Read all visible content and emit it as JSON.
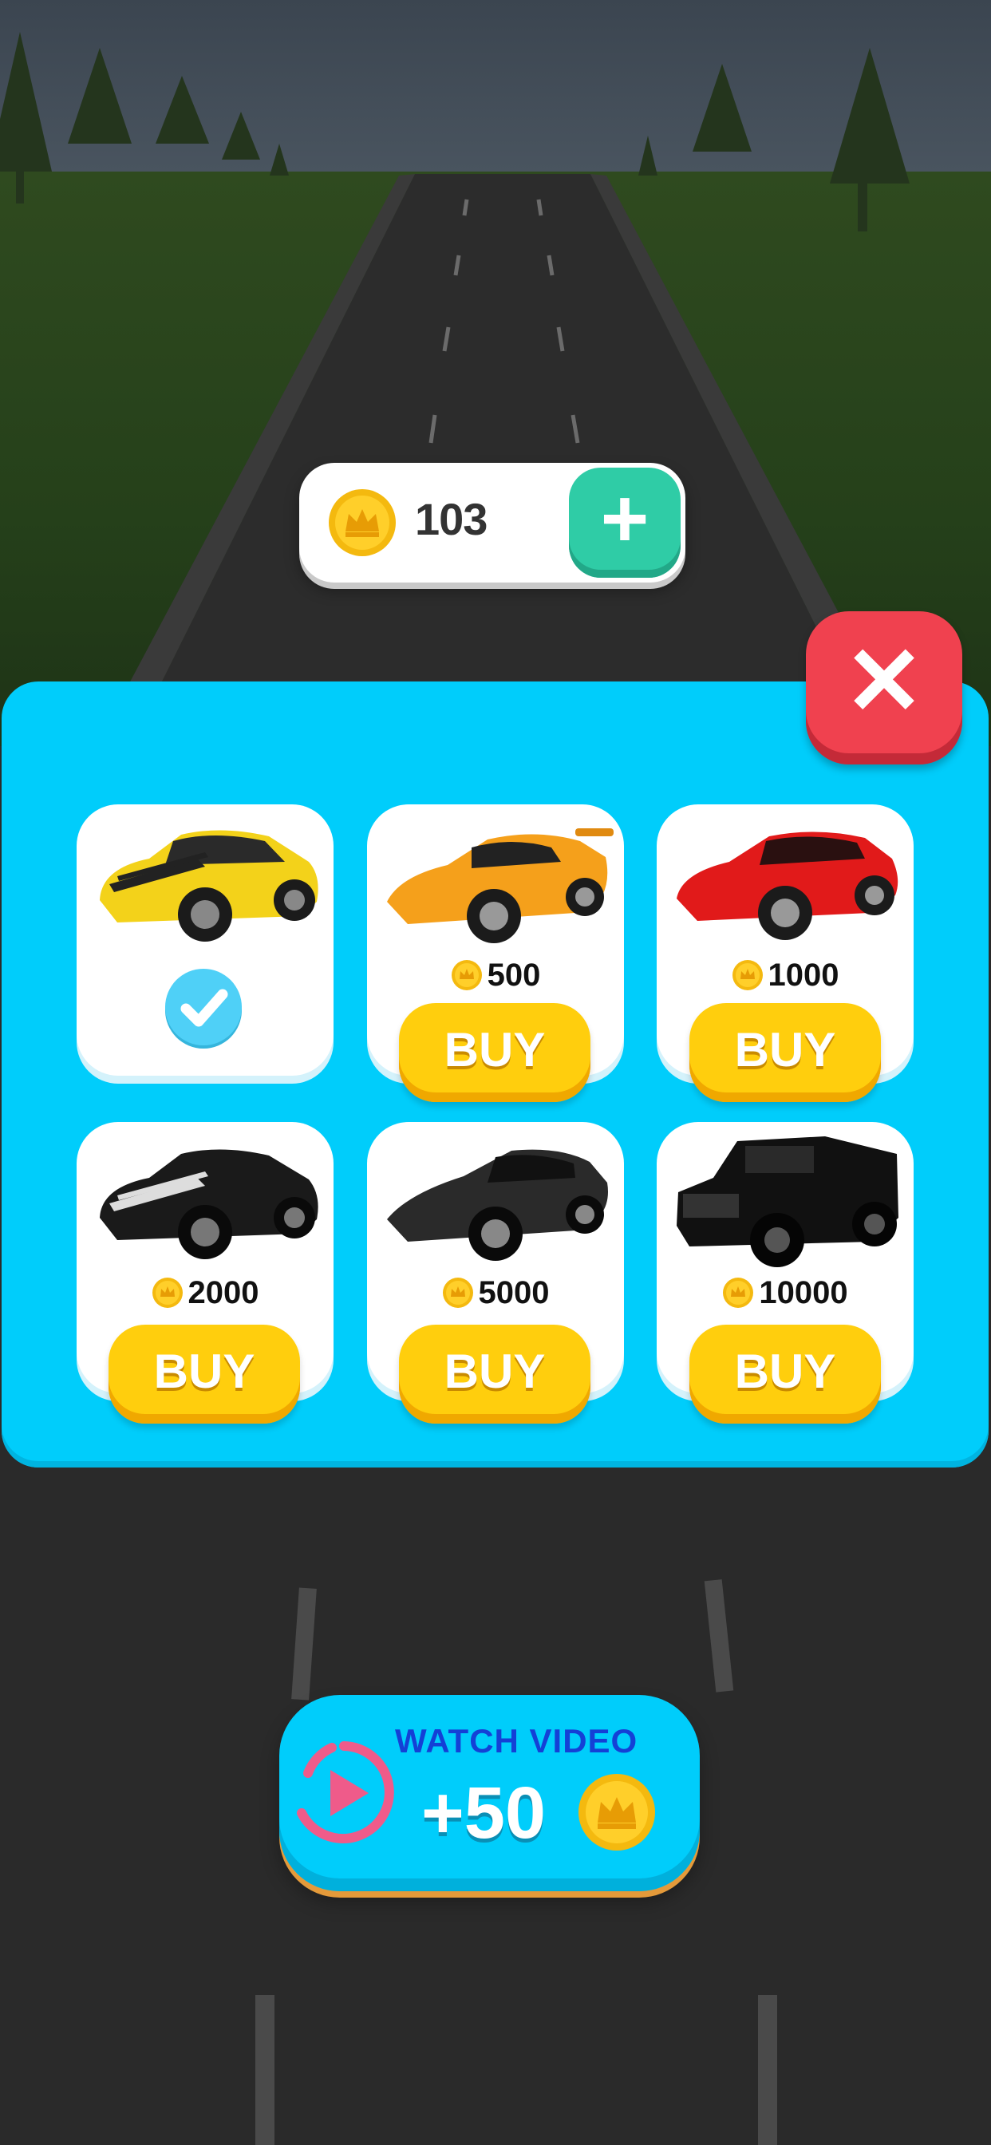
{
  "wallet": {
    "coins": "103",
    "add_label": "+"
  },
  "close": {
    "label": "✕"
  },
  "cars": [
    {
      "name": "yellow-muscle-car",
      "color": "#f3d21a",
      "selected": true,
      "price": "",
      "buy": ""
    },
    {
      "name": "orange-supercar",
      "color": "#f5a01b",
      "selected": false,
      "price": "500",
      "buy": "BUY"
    },
    {
      "name": "red-sports-car",
      "color": "#e11a1a",
      "selected": false,
      "price": "1000",
      "buy": "BUY"
    },
    {
      "name": "black-muscle-car",
      "color": "#1a1a1a",
      "selected": false,
      "price": "2000",
      "buy": "BUY"
    },
    {
      "name": "black-lamborghini",
      "color": "#2a2a2a",
      "selected": false,
      "price": "5000",
      "buy": "BUY"
    },
    {
      "name": "black-hummer",
      "color": "#111111",
      "selected": false,
      "price": "10000",
      "buy": "BUY"
    }
  ],
  "watch_video": {
    "title": "WATCH VIDEO",
    "reward": "+50"
  },
  "colors": {
    "panel": "#00cdfb",
    "buy": "#ffce0d",
    "close": "#f0414f",
    "add": "#2fcca6"
  }
}
